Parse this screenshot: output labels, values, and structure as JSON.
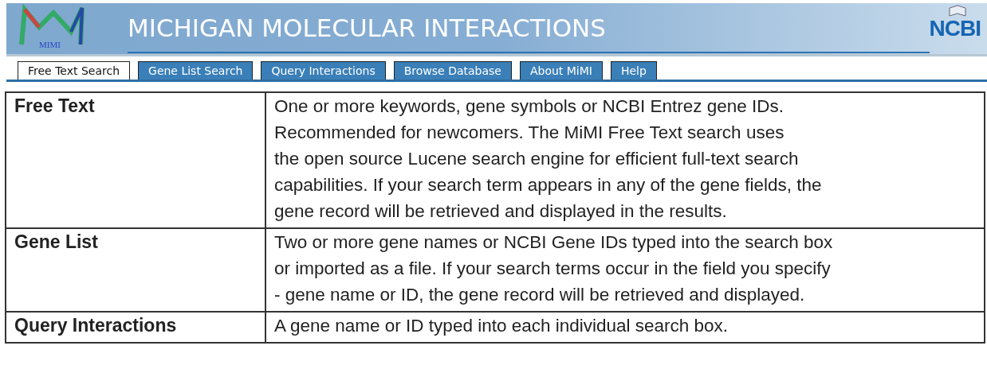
{
  "header": {
    "logo_text": "MIMI",
    "title": "MICHIGAN MOLECULAR INTERACTIONS",
    "partner_logo": "NCBI"
  },
  "tabs": [
    {
      "label": "Free Text Search",
      "selected": true
    },
    {
      "label": "Gene List Search",
      "selected": false
    },
    {
      "label": "Query Interactions",
      "selected": false
    },
    {
      "label": "Browse Database",
      "selected": false
    },
    {
      "label": "About MiMI",
      "selected": false
    },
    {
      "label": "Help",
      "selected": false
    }
  ],
  "table": {
    "rows": [
      {
        "term": "Free Text",
        "lines": [
          "One or more keywords, gene symbols or NCBI Entrez gene IDs.",
          "Recommended for newcomers.  The MiMI Free Text search uses",
          "the open source Lucene search engine for efficient full-text search",
          "capabilities. If your search term appears in any of the gene fields, the",
          "gene record will be retrieved and displayed in the results."
        ]
      },
      {
        "term": "Gene List",
        "lines": [
          "Two or more gene names or NCBI Gene IDs typed into the search box",
          "or imported as a file. If your search terms occur in the field you specify",
          "- gene name or ID, the gene record will be retrieved and displayed."
        ]
      },
      {
        "term": "Query Interactions",
        "lines": [
          "A gene name or ID typed into each individual search box."
        ]
      }
    ]
  }
}
